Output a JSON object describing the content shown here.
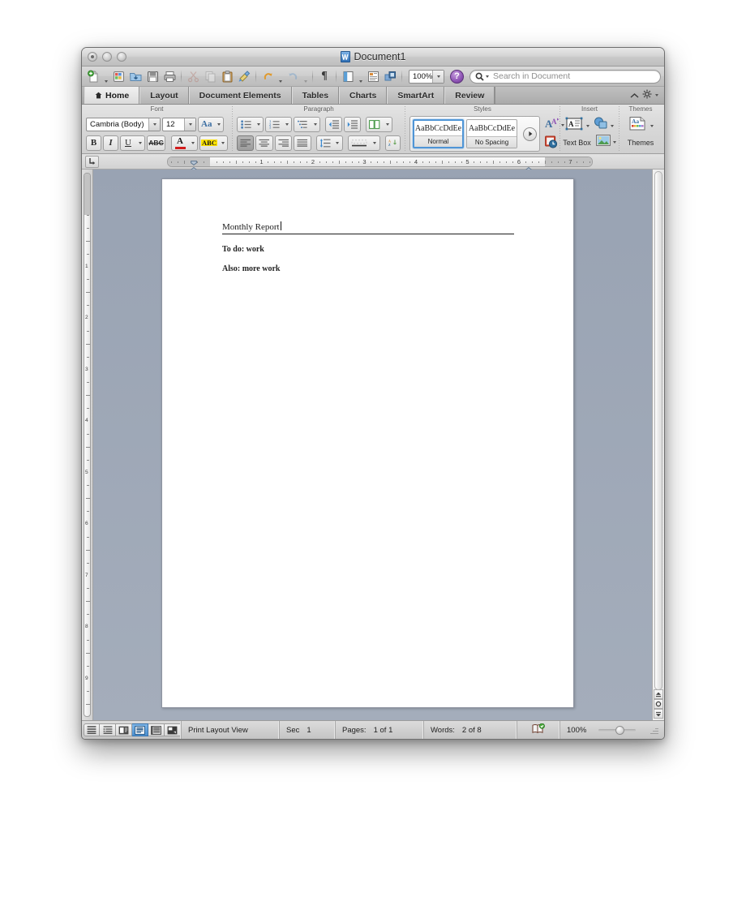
{
  "window": {
    "title": "Document1",
    "doc_icon": "word-document-icon",
    "traffic_lights": [
      "close-button",
      "minimize-button",
      "zoom-button"
    ]
  },
  "toolbar": {
    "items": [
      {
        "name": "new-document-button",
        "icon": "new-document-icon",
        "has_dropdown": true,
        "enabled": true
      },
      {
        "name": "media-browser-button",
        "icon": "media-browser-icon",
        "has_dropdown": false,
        "enabled": true
      },
      {
        "name": "open-button",
        "icon": "open-folder-icon",
        "has_dropdown": false,
        "enabled": true
      },
      {
        "name": "save-button",
        "icon": "floppy-disk-icon",
        "has_dropdown": false,
        "enabled": true
      },
      {
        "name": "print-button",
        "icon": "printer-icon",
        "has_dropdown": false,
        "enabled": true
      },
      {
        "name": "cut-button",
        "icon": "scissors-icon",
        "has_dropdown": false,
        "enabled": false
      },
      {
        "name": "copy-button",
        "icon": "copy-pages-icon",
        "has_dropdown": false,
        "enabled": false
      },
      {
        "name": "paste-button",
        "icon": "clipboard-icon",
        "has_dropdown": false,
        "enabled": true
      },
      {
        "name": "format-painter-button",
        "icon": "paintbrush-icon",
        "has_dropdown": false,
        "enabled": true
      },
      {
        "name": "undo-button",
        "icon": "undo-arrow-icon",
        "has_dropdown": true,
        "enabled": true
      },
      {
        "name": "redo-button",
        "icon": "redo-arrow-icon",
        "has_dropdown": true,
        "enabled": false
      },
      {
        "name": "show-formatting-marks-button",
        "icon": "pilcrow-icon",
        "has_dropdown": false,
        "enabled": true
      },
      {
        "name": "sidebar-button",
        "icon": "sidebar-panel-icon",
        "has_dropdown": true,
        "enabled": true
      },
      {
        "name": "notebook-layout-button",
        "icon": "notebook-icon",
        "has_dropdown": false,
        "enabled": true
      },
      {
        "name": "toolbox-button",
        "icon": "toolbox-icon",
        "has_dropdown": false,
        "enabled": true
      }
    ],
    "zoom_value": "100%",
    "help_label": "?",
    "search_placeholder": "Search in Document",
    "search_value": ""
  },
  "ribbon_tabs": {
    "items": [
      {
        "label": "Home",
        "icon": "home-icon",
        "active": true
      },
      {
        "label": "Layout",
        "icon": "",
        "active": false
      },
      {
        "label": "Document Elements",
        "icon": "",
        "active": false
      },
      {
        "label": "Tables",
        "icon": "",
        "active": false
      },
      {
        "label": "Charts",
        "icon": "",
        "active": false
      },
      {
        "label": "SmartArt",
        "icon": "",
        "active": false
      },
      {
        "label": "Review",
        "icon": "",
        "active": false
      }
    ],
    "collapse_icon": "chevron-up-icon",
    "settings_icon": "gear-icon"
  },
  "ribbon": {
    "groups": [
      {
        "title": "Font"
      },
      {
        "title": "Paragraph"
      },
      {
        "title": "Styles"
      },
      {
        "title": "Insert"
      },
      {
        "title": "Themes"
      }
    ],
    "font": {
      "family_value": "Cambria (Body)",
      "size_value": "12",
      "grow_shrink_icon": "change-case-icon",
      "bold_label": "B",
      "italic_label": "I",
      "underline_label": "U",
      "strikethrough_label": "ABC",
      "font_color_glyph": "A",
      "font_color_hex": "#d21b1b",
      "highlight_glyph": "ABC",
      "highlight_hex": "#ffe400"
    },
    "paragraph": {
      "bullets_icon": "bulleted-list-icon",
      "numbering_icon": "numbered-list-icon",
      "multilevel_icon": "multilevel-list-icon",
      "decrease_indent_icon": "decrease-indent-icon",
      "increase_indent_icon": "increase-indent-icon",
      "columns_icon": "columns-icon",
      "align_left_icon": "align-left-icon",
      "align_center_icon": "align-center-icon",
      "align_right_icon": "align-right-icon",
      "justify_icon": "justify-icon",
      "line_spacing_icon": "line-spacing-icon",
      "borders_icon": "borders-icon",
      "sort_icon": "sort-az-icon"
    },
    "styles": {
      "tiles": [
        {
          "preview": "AaBbCcDdEe",
          "name": "Normal",
          "selected": true
        },
        {
          "preview": "AaBbCcDdEe",
          "name": "No Spacing",
          "selected": false
        }
      ],
      "more_icon": "more-styles-icon",
      "manage_icon": "manage-styles-icon",
      "clock_icon": "styles-history-icon"
    },
    "insert": {
      "text_box_label": "Text Box",
      "text_box_icon": "text-box-icon",
      "shapes_icon": "shapes-icon",
      "picture_icon": "picture-icon"
    },
    "themes": {
      "label": "Themes",
      "icon": "themes-icon"
    }
  },
  "ruler": {
    "tab_selector_icon": "tab-stop-icon",
    "numbers": [
      "1",
      "2",
      "3",
      "4",
      "5",
      "7"
    ],
    "left_indent_marker": "left-indent-marker",
    "right_indent_marker": "right-indent-marker",
    "vertical_numbers": [
      "1",
      "2",
      "3",
      "4",
      "5",
      "6",
      "7",
      "8"
    ]
  },
  "document": {
    "heading": "Monthly Report",
    "paragraphs": [
      "To do: work",
      "Also: more work"
    ],
    "caret_visible": true
  },
  "scrollbar": {
    "up_icon": "scroll-up-icon",
    "select_object_icon": "select-browse-object-icon",
    "down_icon": "scroll-down-icon"
  },
  "statusbar": {
    "view_buttons": [
      {
        "name": "draft-view-button",
        "icon": "draft-view-icon",
        "active": false
      },
      {
        "name": "outline-view-button",
        "icon": "outline-view-icon",
        "active": false
      },
      {
        "name": "publishing-layout-button",
        "icon": "publishing-layout-icon",
        "active": false
      },
      {
        "name": "print-layout-button",
        "icon": "print-layout-icon",
        "active": true
      },
      {
        "name": "notebook-layout-button",
        "icon": "notebook-layout-icon",
        "active": false
      },
      {
        "name": "full-screen-button",
        "icon": "full-screen-icon",
        "active": false
      }
    ],
    "view_name": "Print Layout View",
    "sec_label": "Sec",
    "sec_value": "1",
    "pages_label": "Pages:",
    "pages_value": "1 of 1",
    "words_label": "Words:",
    "words_value": "2 of 8",
    "spellcheck_icon": "spellcheck-book-icon",
    "zoom_value": "100%",
    "resize_grip_icon": "resize-grip-icon"
  }
}
